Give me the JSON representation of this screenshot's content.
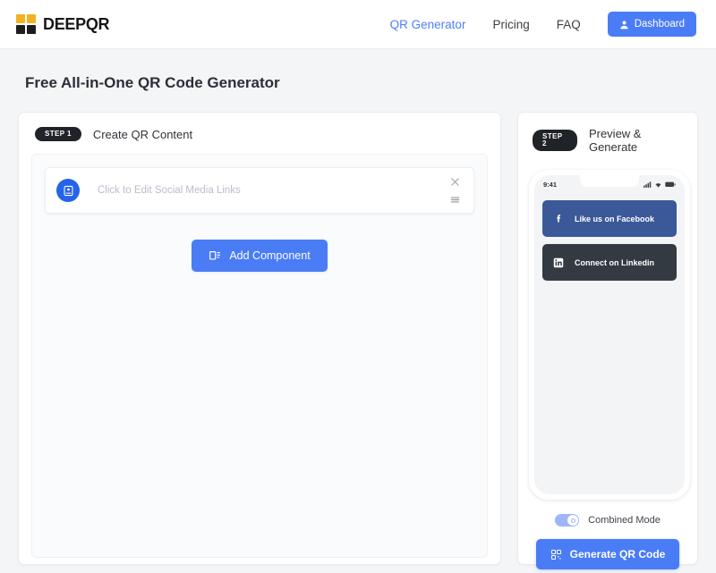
{
  "header": {
    "logo": {
      "text": "DEEPQR",
      "icon": "qr-logo-icon"
    },
    "nav": [
      {
        "label": "QR Generator",
        "active": true
      },
      {
        "label": "Pricing",
        "active": false
      },
      {
        "label": "FAQ",
        "active": false
      }
    ],
    "dashboard_button": {
      "label": "Dashboard",
      "icon": "user-icon"
    }
  },
  "page": {
    "title": "Free All-in-One QR Code Generator"
  },
  "left_panel": {
    "step_badge": "STEP 1",
    "step_title": "Create QR Content",
    "component": {
      "icon": "contact-card-icon",
      "label": "Click to Edit Social Media Links",
      "close_icon": "close-icon",
      "drag_icon": "drag-handle-icon"
    },
    "add_button": {
      "label": "Add Component",
      "icon": "layout-icon"
    }
  },
  "right_panel": {
    "step_badge": "STEP 2",
    "step_title": "Preview & Generate",
    "phone": {
      "status_time": "9:41",
      "status_icons": [
        "signal-icon",
        "wifi-icon",
        "battery-icon"
      ],
      "social_buttons": [
        {
          "label": "Like us on Facebook",
          "icon": "facebook-icon",
          "color": "#3b5998"
        },
        {
          "label": "Connect on Linkedin",
          "icon": "linkedin-icon",
          "color": "#343a42"
        }
      ]
    },
    "toggle": {
      "label": "Combined Mode",
      "state": "on"
    },
    "generate_button": {
      "label": "Generate QR Code",
      "icon": "qr-code-icon"
    }
  },
  "colors": {
    "accent": "#4a7cf6",
    "nav_active": "#4f7ef7",
    "badge": "#202328",
    "page_bg": "#f4f5f7",
    "logo_gold": "#f0b323"
  }
}
